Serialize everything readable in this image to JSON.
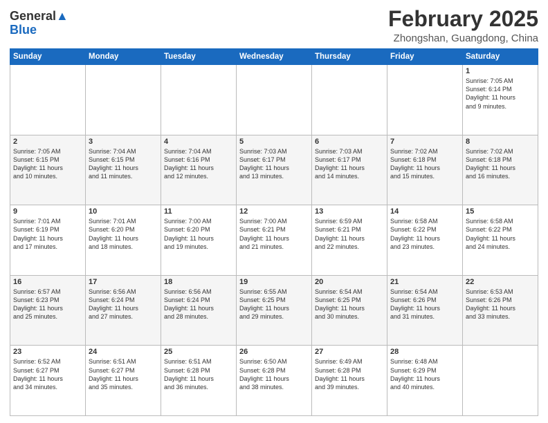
{
  "logo": {
    "general": "General",
    "blue": "Blue"
  },
  "header": {
    "month": "February 2025",
    "location": "Zhongshan, Guangdong, China"
  },
  "weekdays": [
    "Sunday",
    "Monday",
    "Tuesday",
    "Wednesday",
    "Thursday",
    "Friday",
    "Saturday"
  ],
  "weeks": [
    [
      {
        "day": "",
        "info": ""
      },
      {
        "day": "",
        "info": ""
      },
      {
        "day": "",
        "info": ""
      },
      {
        "day": "",
        "info": ""
      },
      {
        "day": "",
        "info": ""
      },
      {
        "day": "",
        "info": ""
      },
      {
        "day": "1",
        "info": "Sunrise: 7:05 AM\nSunset: 6:14 PM\nDaylight: 11 hours\nand 9 minutes."
      }
    ],
    [
      {
        "day": "2",
        "info": "Sunrise: 7:05 AM\nSunset: 6:15 PM\nDaylight: 11 hours\nand 10 minutes."
      },
      {
        "day": "3",
        "info": "Sunrise: 7:04 AM\nSunset: 6:15 PM\nDaylight: 11 hours\nand 11 minutes."
      },
      {
        "day": "4",
        "info": "Sunrise: 7:04 AM\nSunset: 6:16 PM\nDaylight: 11 hours\nand 12 minutes."
      },
      {
        "day": "5",
        "info": "Sunrise: 7:03 AM\nSunset: 6:17 PM\nDaylight: 11 hours\nand 13 minutes."
      },
      {
        "day": "6",
        "info": "Sunrise: 7:03 AM\nSunset: 6:17 PM\nDaylight: 11 hours\nand 14 minutes."
      },
      {
        "day": "7",
        "info": "Sunrise: 7:02 AM\nSunset: 6:18 PM\nDaylight: 11 hours\nand 15 minutes."
      },
      {
        "day": "8",
        "info": "Sunrise: 7:02 AM\nSunset: 6:18 PM\nDaylight: 11 hours\nand 16 minutes."
      }
    ],
    [
      {
        "day": "9",
        "info": "Sunrise: 7:01 AM\nSunset: 6:19 PM\nDaylight: 11 hours\nand 17 minutes."
      },
      {
        "day": "10",
        "info": "Sunrise: 7:01 AM\nSunset: 6:20 PM\nDaylight: 11 hours\nand 18 minutes."
      },
      {
        "day": "11",
        "info": "Sunrise: 7:00 AM\nSunset: 6:20 PM\nDaylight: 11 hours\nand 19 minutes."
      },
      {
        "day": "12",
        "info": "Sunrise: 7:00 AM\nSunset: 6:21 PM\nDaylight: 11 hours\nand 21 minutes."
      },
      {
        "day": "13",
        "info": "Sunrise: 6:59 AM\nSunset: 6:21 PM\nDaylight: 11 hours\nand 22 minutes."
      },
      {
        "day": "14",
        "info": "Sunrise: 6:58 AM\nSunset: 6:22 PM\nDaylight: 11 hours\nand 23 minutes."
      },
      {
        "day": "15",
        "info": "Sunrise: 6:58 AM\nSunset: 6:22 PM\nDaylight: 11 hours\nand 24 minutes."
      }
    ],
    [
      {
        "day": "16",
        "info": "Sunrise: 6:57 AM\nSunset: 6:23 PM\nDaylight: 11 hours\nand 25 minutes."
      },
      {
        "day": "17",
        "info": "Sunrise: 6:56 AM\nSunset: 6:24 PM\nDaylight: 11 hours\nand 27 minutes."
      },
      {
        "day": "18",
        "info": "Sunrise: 6:56 AM\nSunset: 6:24 PM\nDaylight: 11 hours\nand 28 minutes."
      },
      {
        "day": "19",
        "info": "Sunrise: 6:55 AM\nSunset: 6:25 PM\nDaylight: 11 hours\nand 29 minutes."
      },
      {
        "day": "20",
        "info": "Sunrise: 6:54 AM\nSunset: 6:25 PM\nDaylight: 11 hours\nand 30 minutes."
      },
      {
        "day": "21",
        "info": "Sunrise: 6:54 AM\nSunset: 6:26 PM\nDaylight: 11 hours\nand 31 minutes."
      },
      {
        "day": "22",
        "info": "Sunrise: 6:53 AM\nSunset: 6:26 PM\nDaylight: 11 hours\nand 33 minutes."
      }
    ],
    [
      {
        "day": "23",
        "info": "Sunrise: 6:52 AM\nSunset: 6:27 PM\nDaylight: 11 hours\nand 34 minutes."
      },
      {
        "day": "24",
        "info": "Sunrise: 6:51 AM\nSunset: 6:27 PM\nDaylight: 11 hours\nand 35 minutes."
      },
      {
        "day": "25",
        "info": "Sunrise: 6:51 AM\nSunset: 6:28 PM\nDaylight: 11 hours\nand 36 minutes."
      },
      {
        "day": "26",
        "info": "Sunrise: 6:50 AM\nSunset: 6:28 PM\nDaylight: 11 hours\nand 38 minutes."
      },
      {
        "day": "27",
        "info": "Sunrise: 6:49 AM\nSunset: 6:28 PM\nDaylight: 11 hours\nand 39 minutes."
      },
      {
        "day": "28",
        "info": "Sunrise: 6:48 AM\nSunset: 6:29 PM\nDaylight: 11 hours\nand 40 minutes."
      },
      {
        "day": "",
        "info": ""
      }
    ]
  ]
}
